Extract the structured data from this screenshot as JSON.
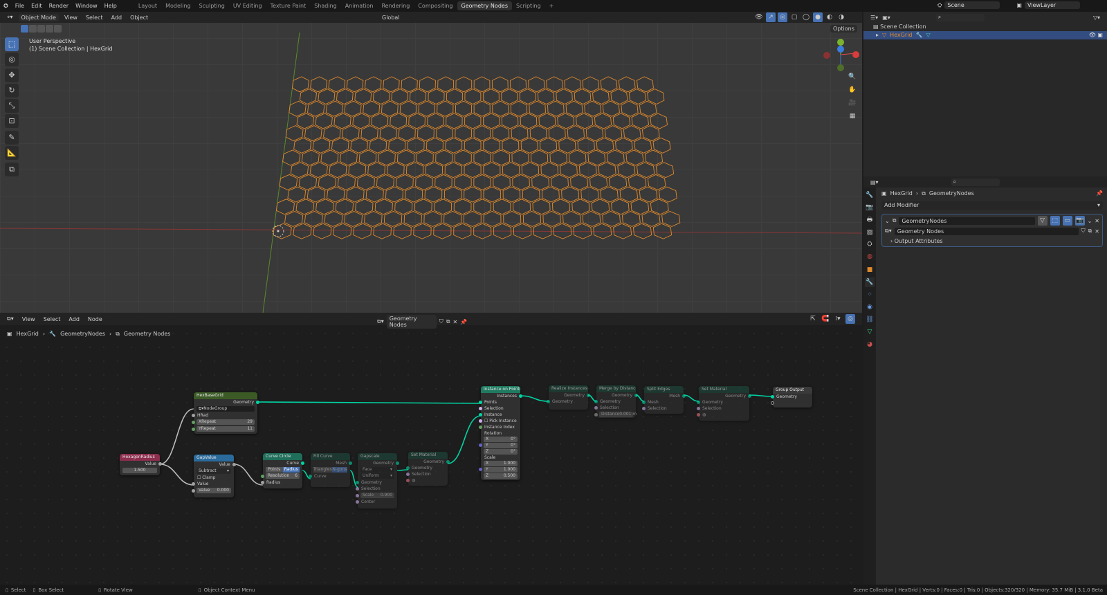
{
  "menubar": {
    "items": [
      "File",
      "Edit",
      "Render",
      "Window",
      "Help"
    ],
    "workspaces": [
      "Layout",
      "Modeling",
      "Sculpting",
      "UV Editing",
      "Texture Paint",
      "Shading",
      "Animation",
      "Rendering",
      "Compositing",
      "Geometry Nodes",
      "Scripting"
    ],
    "active_workspace": "Geometry Nodes",
    "scene": "Scene",
    "view_layer": "ViewLayer"
  },
  "viewport": {
    "mode": "Object Mode",
    "menus": [
      "View",
      "Select",
      "Add",
      "Object"
    ],
    "orientation": "Global",
    "options": "Options",
    "overlay_title": "User Perspective",
    "overlay_subtitle": "(1) Scene Collection | HexGrid",
    "grid": {
      "columns": 20,
      "rows": 13
    },
    "accent": "#e08a2c"
  },
  "outliner": {
    "root": "Scene Collection",
    "items": [
      {
        "name": "HexGrid",
        "selected": true
      }
    ]
  },
  "properties": {
    "breadcrumb": [
      "HexGrid",
      "GeometryNodes"
    ],
    "add_modifier": "Add Modifier",
    "modifier_name": "GeometryNodes",
    "node_group": "Geometry Nodes",
    "output_attributes": "Output Attributes"
  },
  "node_editor": {
    "menus": [
      "View",
      "Select",
      "Add",
      "Node"
    ],
    "node_group": "Geometry Nodes",
    "breadcrumb": [
      "HexGrid",
      "GeometryNodes",
      "Geometry Nodes"
    ],
    "nodes": {
      "hexradius": {
        "title": "HexagonRadius",
        "out": "Value",
        "value": "1.500"
      },
      "hexbase": {
        "title": "HexBaseGrid",
        "out": "Geometry",
        "group": "NodeGroup",
        "in1": "HRad",
        "in2": "XRepeat",
        "v2": "29",
        "in3": "YRepeat",
        "v3": "11"
      },
      "gap": {
        "title": "GapValue",
        "out": "Value",
        "op": "Subtract",
        "clamp": "Clamp",
        "in1": "Value",
        "in2": "Value",
        "v2": "0.000"
      },
      "circle": {
        "title": "Curve Circle",
        "out": "Curve",
        "m1": "Points",
        "m2": "Radius",
        "res": "Resolution",
        "resv": "6",
        "in": "Radius"
      },
      "fill": {
        "title": "Fill Curve",
        "out": "Mesh",
        "m1": "Triangles",
        "m2": "N-gons",
        "in": "Curve"
      },
      "gapscale": {
        "title": "Gapscale",
        "out": "Geometry",
        "d1": "Face",
        "d2": "Uniform",
        "in1": "Geometry",
        "in2": "Selection",
        "in3": "Scale",
        "v3": "0.900",
        "in4": "Center"
      },
      "setmat1": {
        "title": "Set Material",
        "out": "Geometry",
        "in1": "Geometry",
        "in2": "Selection"
      },
      "iop": {
        "title": "Instance on Points",
        "out": "Instances",
        "in": [
          "Points",
          "Selection",
          "Instance",
          "Pick Instance",
          "Instance Index"
        ],
        "rotation": "Rotation",
        "rot": [
          [
            "X",
            "0°"
          ],
          [
            "Y",
            "0°"
          ],
          [
            "Z",
            "0°"
          ]
        ],
        "scale": "Scale",
        "scl": [
          [
            "X",
            "1.000"
          ],
          [
            "Y",
            "1.000"
          ],
          [
            "Z",
            "0.500"
          ]
        ]
      },
      "realize": {
        "title": "Realize Instances",
        "out": "Geometry",
        "in": "Geometry"
      },
      "merge": {
        "title": "Merge by Distance",
        "out": "Geometry",
        "in1": "Geometry",
        "in2": "Selection",
        "in3": "Distance",
        "v3": "0.001 m"
      },
      "split": {
        "title": "Split Edges",
        "out": "Mesh",
        "in1": "Mesh",
        "in2": "Selection"
      },
      "setmat2": {
        "title": "Set Material",
        "out": "Geometry",
        "in1": "Geometry",
        "in2": "Selection"
      },
      "output": {
        "title": "Group Output",
        "in": "Geometry"
      }
    }
  },
  "statusbar": {
    "left": [
      "Select",
      "Box Select",
      "Rotate View",
      "Object Context Menu"
    ],
    "right": "Scene Collection | HexGrid | Verts:0 | Faces:0 | Tris:0 | Objects:320/320 | Memory: 35.7 MiB | 3.1.0 Beta"
  }
}
